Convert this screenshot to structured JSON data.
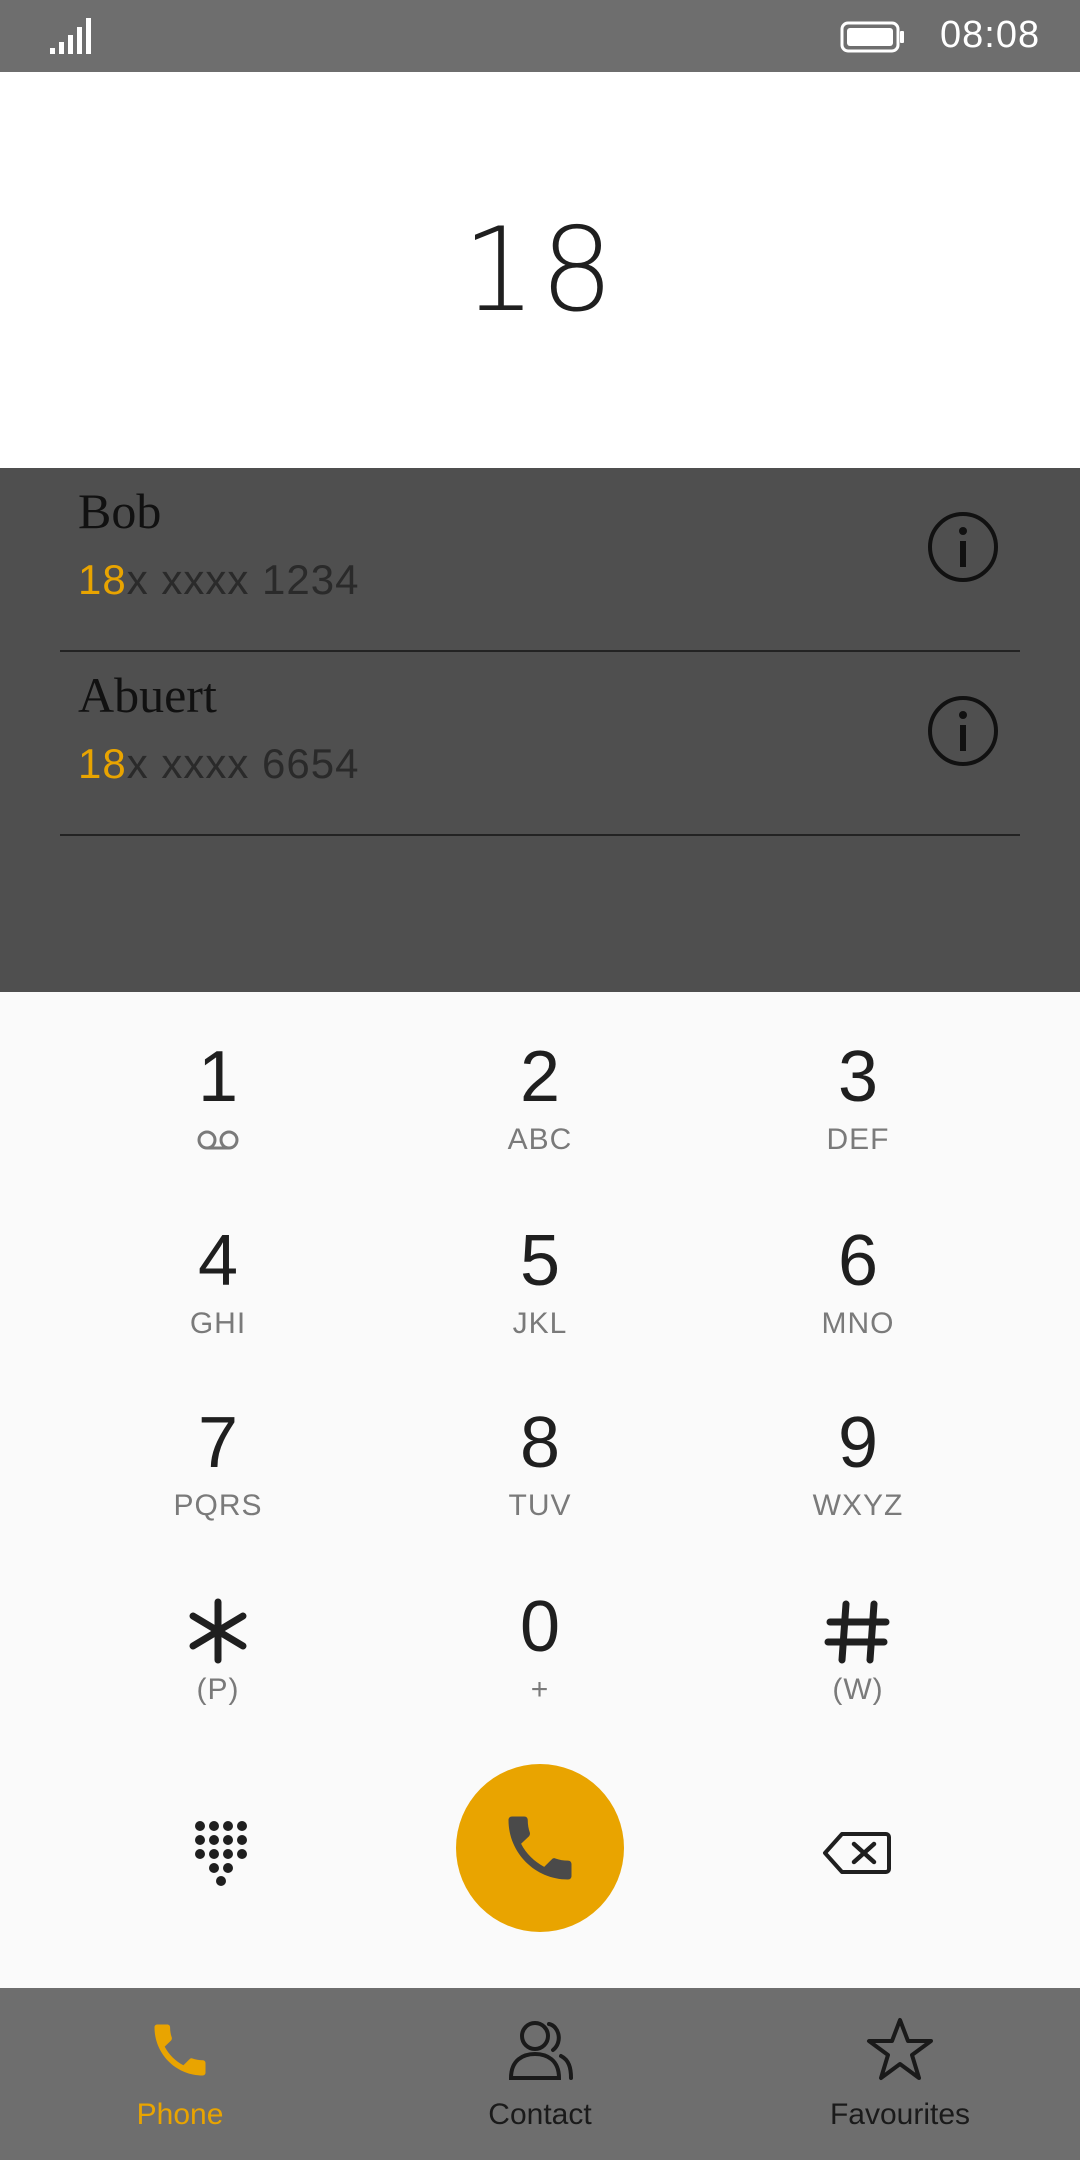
{
  "status_bar": {
    "time": "08:08",
    "signal_icon": "signal-icon",
    "battery_icon": "battery-icon"
  },
  "dialer": {
    "number": "18"
  },
  "results": [
    {
      "name": "Bob",
      "match": "18",
      "rest": "x xxxx 1234",
      "icon": "info-icon"
    },
    {
      "name": "Abuert",
      "match": "18",
      "rest": "x xxxx 6654",
      "icon": "info-icon"
    }
  ],
  "keypad": {
    "keys": [
      {
        "digit": "1",
        "sub": ""
      },
      {
        "digit": "2",
        "sub": "ABC"
      },
      {
        "digit": "3",
        "sub": "DEF"
      },
      {
        "digit": "4",
        "sub": "GHI"
      },
      {
        "digit": "5",
        "sub": "JKL"
      },
      {
        "digit": "6",
        "sub": "MNO"
      },
      {
        "digit": "7",
        "sub": "PQRS"
      },
      {
        "digit": "8",
        "sub": "TUV"
      },
      {
        "digit": "9",
        "sub": "WXYZ"
      },
      {
        "digit": "",
        "sub": "(P)"
      },
      {
        "digit": "0",
        "sub": "+"
      },
      {
        "digit": "",
        "sub": "(W)"
      }
    ]
  },
  "actions": {
    "dialpad_icon": "dialpad-icon",
    "call_icon": "phone-icon",
    "backspace_icon": "backspace-icon"
  },
  "nav": {
    "items": [
      {
        "label": "Phone",
        "icon": "phone-icon",
        "active": true
      },
      {
        "label": "Contact",
        "icon": "contact-icon",
        "active": false
      },
      {
        "label": "Favourites",
        "icon": "star-icon",
        "active": false
      }
    ]
  },
  "colors": {
    "accent": "#e9a400",
    "bar": "#6e6e6e",
    "results_bg": "#4f4f4f",
    "keypad_bg": "#fafafa"
  }
}
